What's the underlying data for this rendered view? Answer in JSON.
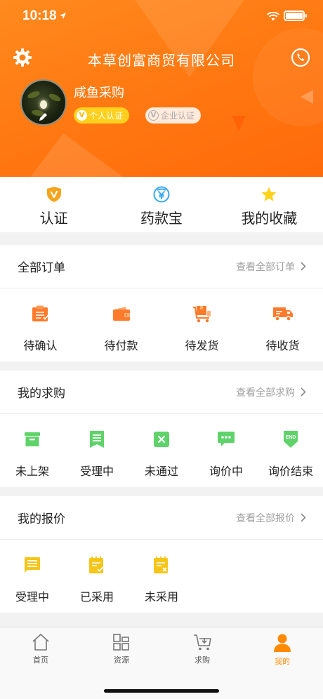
{
  "status_bar": {
    "time": "10:18"
  },
  "header": {
    "company": "本草创富商贸有限公司",
    "username": "咸鱼采购",
    "badges": {
      "personal": "个人认证",
      "enterprise": "企业认证",
      "v": "V"
    }
  },
  "quick": [
    {
      "label": "认证",
      "icon": "shield-v-icon",
      "color": "#f3a51e"
    },
    {
      "label": "药款宝",
      "icon": "yen-shield-icon",
      "color": "#36a8f0"
    },
    {
      "label": "我的收藏",
      "icon": "star-icon",
      "color": "#ffd21a"
    }
  ],
  "orders": {
    "title": "全部订单",
    "more": "查看全部订单",
    "items": [
      {
        "label": "待确认",
        "icon": "clipboard-icon"
      },
      {
        "label": "待付款",
        "icon": "wallet-icon"
      },
      {
        "label": "待发货",
        "icon": "package-cart-icon"
      },
      {
        "label": "待收货",
        "icon": "truck-icon"
      }
    ],
    "color": "#ff7a2a"
  },
  "purchases": {
    "title": "我的求购",
    "more": "查看全部求购",
    "items": [
      {
        "label": "未上架",
        "icon": "archive-icon"
      },
      {
        "label": "受理中",
        "icon": "document-bookmark-icon"
      },
      {
        "label": "未通过",
        "icon": "x-box-icon"
      },
      {
        "label": "询价中",
        "icon": "chat-bubble-icon"
      },
      {
        "label": "询价结束",
        "icon": "end-shield-icon",
        "icon_text": "END"
      }
    ],
    "color": "#5fd36a"
  },
  "quotes": {
    "title": "我的报价",
    "more": "查看全部报价",
    "items": [
      {
        "label": "受理中",
        "icon": "document-lines-icon"
      },
      {
        "label": "已采用",
        "icon": "clipboard-check-icon"
      },
      {
        "label": "未采用",
        "icon": "clipboard-x-icon"
      }
    ],
    "color": "#f5c518"
  },
  "tabbar": {
    "items": [
      {
        "label": "首页",
        "icon": "home-icon"
      },
      {
        "label": "资源",
        "icon": "grid-icon"
      },
      {
        "label": "求购",
        "icon": "cart-icon"
      },
      {
        "label": "我的",
        "icon": "person-icon",
        "active": true
      }
    ],
    "active_color": "#ff8a00"
  }
}
